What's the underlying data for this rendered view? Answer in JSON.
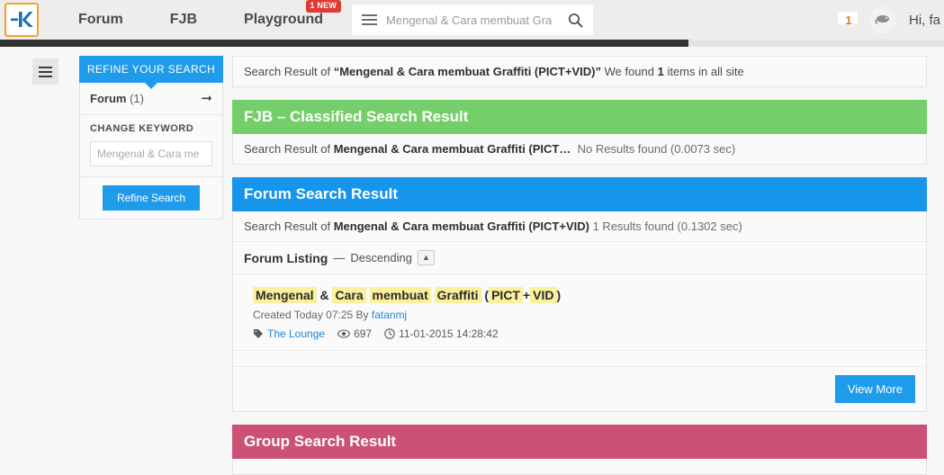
{
  "header": {
    "logo_alt": "Kaskus",
    "nav": [
      {
        "label": "Forum",
        "badge": null
      },
      {
        "label": "FJB",
        "badge": null
      },
      {
        "label": "Playground",
        "badge": "1 NEW"
      }
    ],
    "search_value": "Mengenal & Cara membuat Gra",
    "search_placeholder": "Mengenal & Cara membuat Gra",
    "notification_count": "1",
    "greeting": "Hi, fa"
  },
  "sidebar": {
    "refine_tab": "REFINE YOUR SEARCH",
    "forum_row": {
      "label": "Forum",
      "count": "(1)"
    },
    "change_keyword_title": "CHANGE KEYWORD",
    "keyword_value": "",
    "keyword_placeholder": "Mengenal & Cara me",
    "refine_button": "Refine Search"
  },
  "main": {
    "result_summary": {
      "prefix": "Search Result of ",
      "query": "“Mengenal & Cara membuat Graffiti (PICT+VID)”",
      "middle": " We found ",
      "count": "1",
      "suffix": " items in all site"
    },
    "sections": [
      {
        "id": "fjb",
        "title": "FJB – Classified Search Result",
        "color": "#74ce69",
        "line_prefix": "Search Result of ",
        "line_query": "Mengenal & Cara membuat Graffiti (PICT…",
        "line_status": "No Results found (0.0073 sec)"
      },
      {
        "id": "forum",
        "title": "Forum Search Result",
        "color": "#1795eb",
        "line_prefix": "Search Result of ",
        "line_query": "Mengenal & Cara membuat Graffiti (PICT+VID)",
        "line_status": "1 Results found (0.1302 sec)",
        "listing_label": "Forum Listing",
        "listing_dash": "—",
        "listing_order": "Descending",
        "sort_icon": "chevron-up-icon",
        "view_more": "View More",
        "items": [
          {
            "title_parts": [
              {
                "text": "Mengenal",
                "highlight": true
              },
              {
                "text": "&",
                "highlight": false
              },
              {
                "text": "Cara",
                "highlight": true
              },
              {
                "text": "membuat",
                "highlight": true
              },
              {
                "text": "Graffiti",
                "highlight": true
              },
              {
                "text": "(",
                "highlight": false
              },
              {
                "text": "PICT",
                "highlight": true
              },
              {
                "text": "+",
                "highlight": false
              },
              {
                "text": "VID",
                "highlight": true
              },
              {
                "text": ")",
                "highlight": false
              }
            ],
            "created": "Created Today 07:25 By ",
            "author": "fatanmj",
            "forum": "The Lounge",
            "views": "697",
            "timestamp": "11-01-2015 14:28:42"
          }
        ]
      },
      {
        "id": "group",
        "title": "Group Search Result",
        "color": "#cb5175"
      }
    ]
  }
}
